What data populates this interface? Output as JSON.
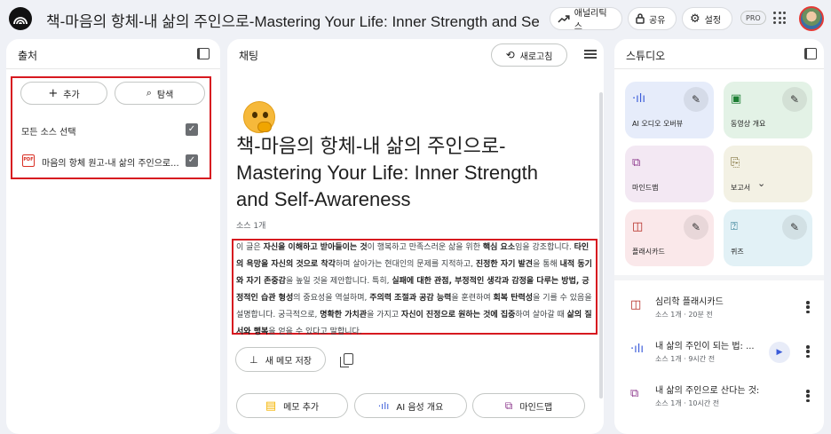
{
  "header": {
    "title": "책-마음의 항체-내 삶의 주인으로-Mastering Your Life:  Inner Strength and Self-A",
    "analytics_label": "애널리틱스",
    "share_label": "공유",
    "settings_label": "설정",
    "plan_badge": "PRO"
  },
  "sources": {
    "title": "출처",
    "add_label": "추가",
    "explore_label": "탐색",
    "select_all_label": "모든 소스 선택",
    "items": [
      {
        "label": "마음의 항체 원고-내 삶의 주인으로...",
        "icon": "pdf-icon",
        "icon_text": "PDF"
      }
    ]
  },
  "chat": {
    "title": "채팅",
    "refresh_label": "새로고침",
    "notebook_title": "책-마음의 항체-내 삶의 주인으로-Mastering Your Life: Inner Strength and Self-Awareness",
    "source_count": "소스 1개",
    "summary_html": "이 글은 <b>자신을 이해하고 받아들이는 것</b>이 행복하고 만족스러운 삶을 위한 <b>핵심 요소</b>임을 강조합니다. <b>타인의 욕망을 자신의 것으로 착각</b>하며 살아가는 현대인의 문제를 지적하고, <b>진정한 자기 발견</b>을 통해 <b>내적 동기와 자기 존중감</b>을 높일 것을 제안합니다. 특히, <b>실패에 대한 관점, 부정적인 생각과 감정을 다루는 방법, 긍정적인 습관 형성</b>의 중요성을 역설하며, <b>주의력 조절과 공감 능력</b>을 훈련하여 <b>회복 탄력성</b>을 기를 수 있음을 설명합니다. 궁극적으로, <b>명확한 가치관</b>을 가지고 <b>자신이 진정으로 원하는 것에 집중</b>하여 살아갈 때 <b>삶의 질서와 행복</b>을 얻을 수 있다고 말합니다.",
    "save_note_label": "새 메모 저장",
    "actions": {
      "add_note_label": "메모 추가",
      "audio_overview_label": "AI 음성 개요",
      "mindmap_label": "마인드맵"
    }
  },
  "studio": {
    "title": "스튜디오",
    "tiles": [
      {
        "label": "AI 오디오 오버뷰",
        "color": "#e6ecfa",
        "icon": "audio-icon",
        "glyph": "·ılı",
        "glyph_color": "#3a5bd9",
        "editable": true
      },
      {
        "label": "동영상 개요",
        "color": "#e3f2e6",
        "icon": "video-icon",
        "glyph": "▣",
        "glyph_color": "#1e7e34",
        "editable": true
      },
      {
        "label": "마인드맵",
        "color": "#f3e8f3",
        "icon": "mindmap-icon",
        "glyph": "⧉",
        "glyph_color": "#8e3a8e",
        "editable": false
      },
      {
        "label": "보고서",
        "color": "#f3f1e4",
        "icon": "report-icon",
        "glyph": "⎘",
        "glyph_color": "#6b5a1e",
        "editable": false
      },
      {
        "label": "플래시카드",
        "color": "#fae8ea",
        "icon": "flashcard-icon",
        "glyph": "◫",
        "glyph_color": "#b3261e",
        "editable": true
      },
      {
        "label": "퀴즈",
        "color": "#e2f1f6",
        "icon": "quiz-icon",
        "glyph": "⍰",
        "glyph_color": "#1b6d87",
        "editable": true
      }
    ],
    "report_chevron": "⌄",
    "outputs": [
      {
        "title": "심리학 플래시카드",
        "meta": "소스 1개 · 20분 전",
        "icon": "flashcard-icon",
        "glyph": "◫",
        "color": "#b3261e"
      },
      {
        "title": "내 삶의 주인이 되는 법: ...",
        "meta": "소스 1개 · 9시간 전",
        "icon": "audio-icon",
        "glyph": "·ılı",
        "color": "#3a5bd9",
        "playable": true
      },
      {
        "title": "내 삶의 주인으로 산다는 것: 마...",
        "meta": "소스 1개 · 10시간 전",
        "icon": "mindmap-icon",
        "glyph": "⧉",
        "color": "#8e3a8e"
      }
    ]
  }
}
